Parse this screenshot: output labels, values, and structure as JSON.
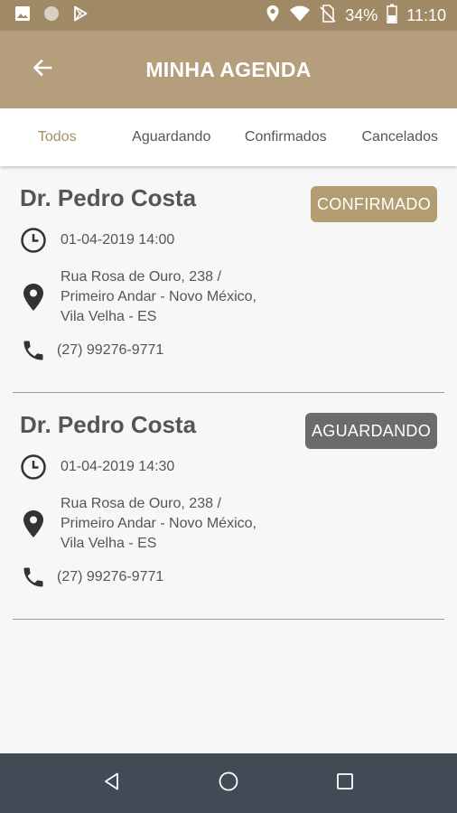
{
  "status_bar": {
    "left_icons": [
      "image-icon",
      "circle-icon",
      "play-store-icon"
    ],
    "right_icons": [
      "location-icon",
      "wifi-icon",
      "no-sim-icon",
      "battery-icon"
    ],
    "battery": "34%",
    "time": "11:10"
  },
  "header": {
    "back_icon": "arrow-left-icon",
    "title": "MINHA AGENDA"
  },
  "tabs": [
    {
      "label": "Todos",
      "active": true
    },
    {
      "label": "Aguardando",
      "active": false
    },
    {
      "label": "Confirmados",
      "active": false
    },
    {
      "label": "Cancelados",
      "active": false
    }
  ],
  "appointments": [
    {
      "doctor": "Dr. Pedro Costa",
      "status": "CONFIRMADO",
      "status_color": "#b39b72",
      "datetime": "01-04-2019 14:00",
      "address_lines": [
        "Rua Rosa de Ouro, 238 /",
        "Primeiro Andar - Novo México,",
        "Vila Velha - ES"
      ],
      "phone": "(27) 99276-9771"
    },
    {
      "doctor": "Dr. Pedro Costa",
      "status": "AGUARDANDO",
      "status_color": "#6b6b6b",
      "datetime": "01-04-2019 14:30",
      "address_lines": [
        "Rua Rosa de Ouro, 238 /",
        "Primeiro Andar - Novo México,",
        "Vila Velha - ES"
      ],
      "phone": "(27) 99276-9771"
    }
  ],
  "nav_bar": {
    "icons": [
      "back-triangle-icon",
      "home-circle-icon",
      "recents-square-icon"
    ]
  },
  "colors": {
    "status_bar": "#a08a66",
    "app_bar": "#b59e7b",
    "active_tab": "#a59064",
    "nav_bar": "#424a55"
  }
}
